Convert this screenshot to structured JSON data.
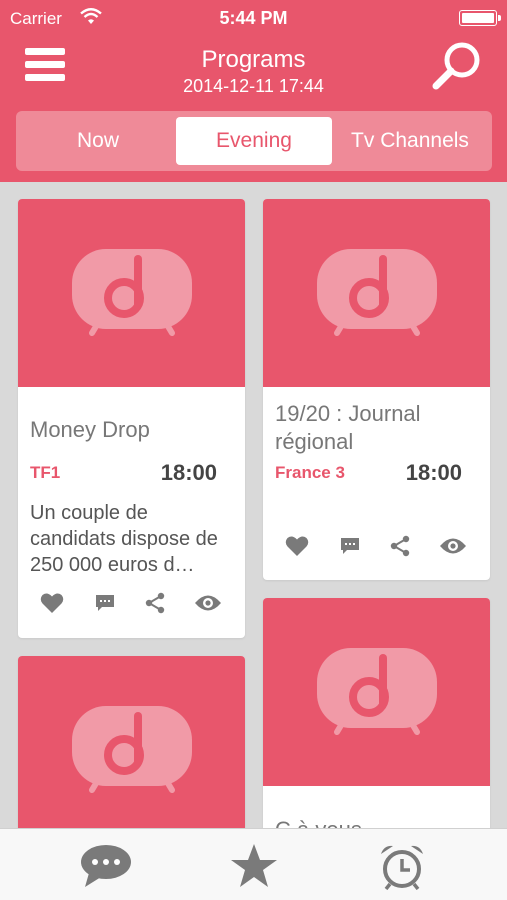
{
  "status_bar": {
    "carrier": "Carrier",
    "time": "5:44 PM"
  },
  "header": {
    "title": "Programs",
    "subtitle": "2014-12-11 17:44",
    "tabs": [
      {
        "label": "Now",
        "active": false
      },
      {
        "label": "Evening",
        "active": true
      },
      {
        "label": "Tv Channels",
        "active": false
      }
    ]
  },
  "cards": [
    {
      "title": "Money Drop",
      "channel": "TF1",
      "time": "18:00",
      "description": "Un couple de candidats dispose de 250 000 euros d…"
    },
    {
      "title": "19/20 : Journal régional",
      "channel": "France 3",
      "time": "18:00",
      "description": ""
    },
    {
      "title": "C à vous",
      "channel": "",
      "time": "",
      "description": ""
    }
  ],
  "colors": {
    "accent": "#e8566c",
    "thumb_logo": "#f19aa7",
    "icon_gray": "#7a7a7a"
  },
  "icons": [
    "menu-icon",
    "search-icon",
    "heart-icon",
    "comment-icon",
    "share-icon",
    "eye-icon",
    "chat-bubbles-icon",
    "star-icon",
    "alarm-clock-icon"
  ]
}
